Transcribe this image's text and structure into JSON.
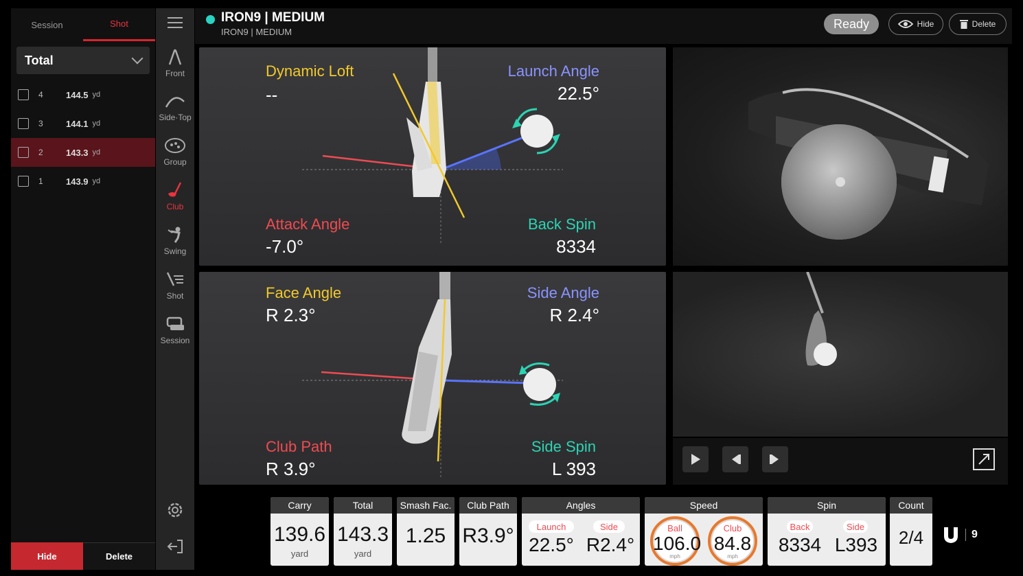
{
  "left_panel": {
    "tabs": [
      {
        "label": "Session",
        "active": false
      },
      {
        "label": "Shot",
        "active": true
      }
    ],
    "filter": {
      "selected": "Total"
    },
    "shots": [
      {
        "num": "4",
        "dist": "144.5",
        "unit": "yd",
        "selected": false
      },
      {
        "num": "3",
        "dist": "144.1",
        "unit": "yd",
        "selected": false
      },
      {
        "num": "2",
        "dist": "143.3",
        "unit": "yd",
        "selected": true
      },
      {
        "num": "1",
        "dist": "143.9",
        "unit": "yd",
        "selected": false
      }
    ],
    "hide_label": "Hide",
    "delete_label": "Delete"
  },
  "nav": {
    "items": [
      {
        "label": "Front",
        "icon": "front-icon"
      },
      {
        "label": "Side·Top",
        "icon": "side-top-icon"
      },
      {
        "label": "Group",
        "icon": "group-icon"
      },
      {
        "label": "Club",
        "icon": "club-icon",
        "active": true
      },
      {
        "label": "Swing",
        "icon": "swing-icon"
      },
      {
        "label": "Shot",
        "icon": "shot-icon"
      },
      {
        "label": "Session",
        "icon": "session-icon"
      }
    ]
  },
  "header": {
    "title": "IRON9 | MEDIUM",
    "subtitle": "IRON9 | MEDIUM",
    "status": "Ready",
    "hide_label": "Hide",
    "delete_label": "Delete"
  },
  "diagram_side": {
    "dynamic_loft": {
      "label": "Dynamic Loft",
      "value": "--"
    },
    "launch_angle": {
      "label": "Launch Angle",
      "value": "22.5°"
    },
    "attack_angle": {
      "label": "Attack Angle",
      "value": "-7.0°"
    },
    "back_spin": {
      "label": "Back Spin",
      "value": "8334"
    }
  },
  "diagram_top": {
    "face_angle": {
      "label": "Face Angle",
      "value": "R 2.3°"
    },
    "side_angle": {
      "label": "Side Angle",
      "value": "R 2.4°"
    },
    "club_path": {
      "label": "Club Path",
      "value": "R 3.9°"
    },
    "side_spin": {
      "label": "Side Spin",
      "value": "L 393"
    }
  },
  "stats": {
    "carry": {
      "label": "Carry",
      "value": "139.6",
      "unit": "yard"
    },
    "total": {
      "label": "Total",
      "value": "143.3",
      "unit": "yard"
    },
    "smash": {
      "label": "Smash Fac.",
      "value": "1.25"
    },
    "club_path": {
      "label": "Club Path",
      "value": "R3.9°"
    },
    "angles": {
      "label": "Angles",
      "launch_label": "Launch",
      "launch": "22.5°",
      "side_label": "Side",
      "side": "R2.4°"
    },
    "speed": {
      "label": "Speed",
      "ball_label": "Ball",
      "ball": "106.0",
      "club_label": "Club",
      "club": "84.8",
      "unit": "mph"
    },
    "spin": {
      "label": "Spin",
      "back_label": "Back",
      "back": "8334",
      "side_label": "Side",
      "side": "L393"
    },
    "count": {
      "label": "Count",
      "value": "2/4"
    }
  },
  "logo": {
    "num": "9"
  },
  "colors": {
    "accent": "#d9242e",
    "status_dot": "#2ad3c2",
    "loft": "#f2c92b",
    "launch": "#8a93ff",
    "attack": "#ef4b52",
    "spin": "#2cd4b3"
  }
}
